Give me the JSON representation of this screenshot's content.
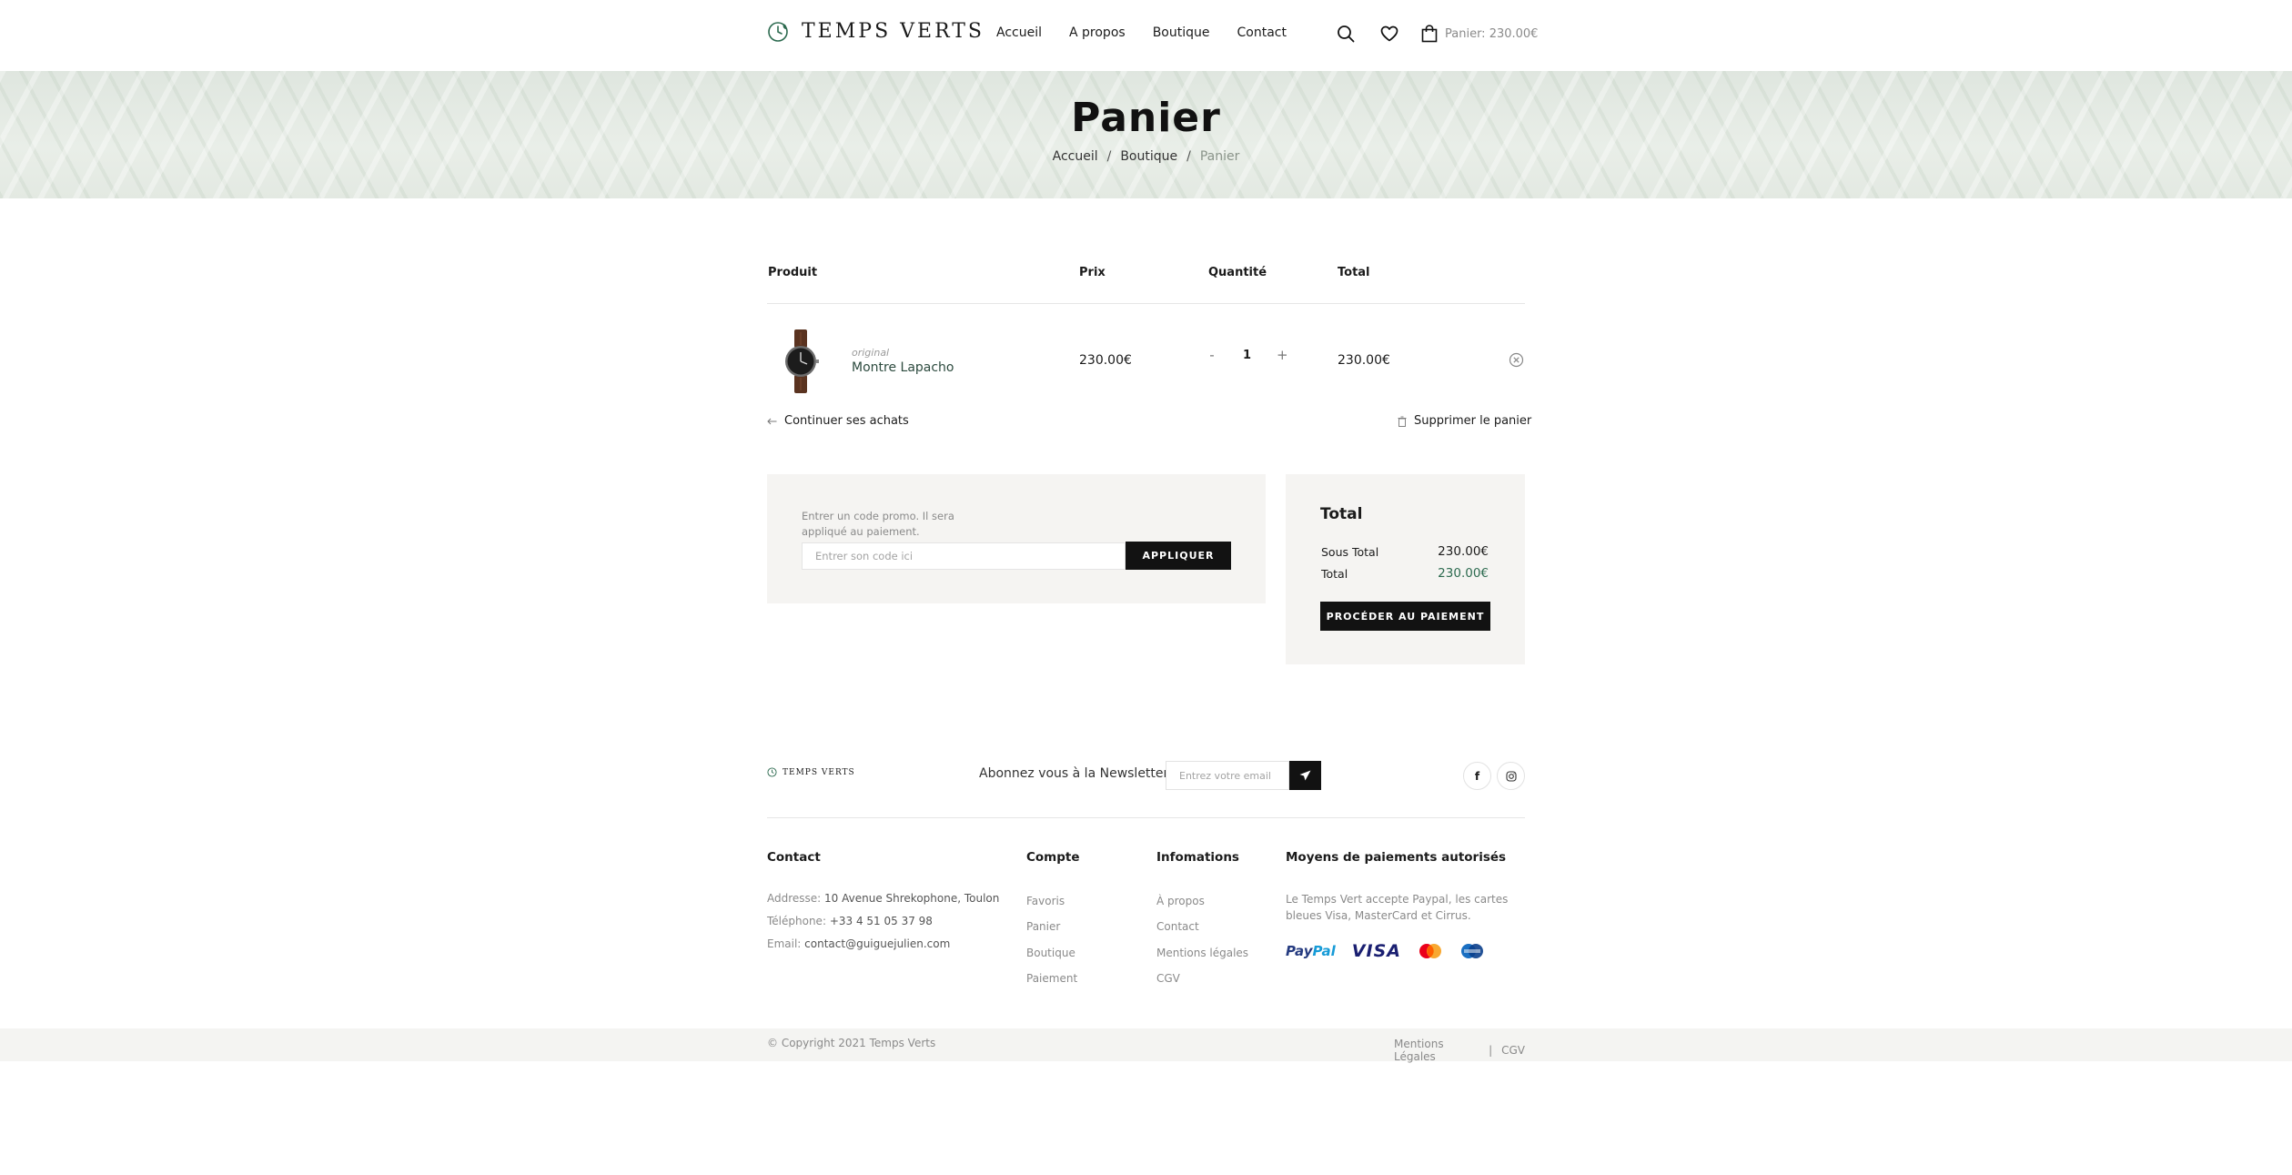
{
  "brand": {
    "name": "TEMPS VERTS",
    "accent": "#2c6a4f"
  },
  "nav": {
    "items": [
      "Accueil",
      "A propos",
      "Boutique",
      "Contact"
    ]
  },
  "header": {
    "cart_label": "Panier: 230.00€",
    "icons": [
      "search-icon",
      "heart-icon",
      "shopping-bag-icon"
    ]
  },
  "hero": {
    "title": "Panier",
    "breadcrumb": {
      "home": "Accueil",
      "shop": "Boutique",
      "current": "Panier",
      "separator": "/"
    }
  },
  "cart": {
    "headers": {
      "product": "Produit",
      "price": "Prix",
      "quantity": "Quantité",
      "total": "Total"
    },
    "items": [
      {
        "category": "original",
        "name": "Montre Lapacho",
        "price": "230.00€",
        "quantity": "1",
        "total": "230.00€"
      }
    ],
    "qty_minus": "-",
    "qty_plus": "+",
    "continue_label": "Continuer ses achats",
    "clear_label": "Supprimer le panier"
  },
  "promo": {
    "help": "Entrer un code promo. Il sera appliqué au paiement.",
    "placeholder": "Entrer son code ici",
    "button": "APPLIQUER"
  },
  "totals": {
    "title": "Total",
    "subtotal_label": "Sous Total",
    "subtotal_value": "230.00€",
    "total_label": "Total",
    "total_value": "230.00€",
    "checkout_button": "PROCÉDER AU PAIEMENT"
  },
  "newsletter": {
    "label": "Abonnez vous à la Newsletter:",
    "placeholder": "Entrez votre email"
  },
  "social": {
    "facebook": "f"
  },
  "footer": {
    "contact": {
      "title": "Contact",
      "address_label": "Addresse:",
      "address_value": "10 Avenue Shrekophone, Toulon",
      "phone_label": "Téléphone:",
      "phone_value": "+33 4 51 05 37 98",
      "email_label": "Email:",
      "email_value": "contact@guiguejulien.com"
    },
    "account": {
      "title": "Compte",
      "links": [
        "Favoris",
        "Panier",
        "Boutique",
        "Paiement"
      ]
    },
    "info": {
      "title": "Infomations",
      "links": [
        "À propos",
        "Contact",
        "Mentions légales",
        "CGV"
      ]
    },
    "payments": {
      "title": "Moyens de paiements autorisés",
      "text": "Le Temps Vert accepte Paypal, les cartes bleues Visa, MasterCard et Cirrus.",
      "paypal_a": "Pay",
      "paypal_b": "Pal",
      "visa": "VISA"
    },
    "copyright": "© Copyright 2021 Temps Verts",
    "bottom_links": [
      "Mentions Légales",
      "CGV"
    ],
    "bottom_separator": "|"
  }
}
